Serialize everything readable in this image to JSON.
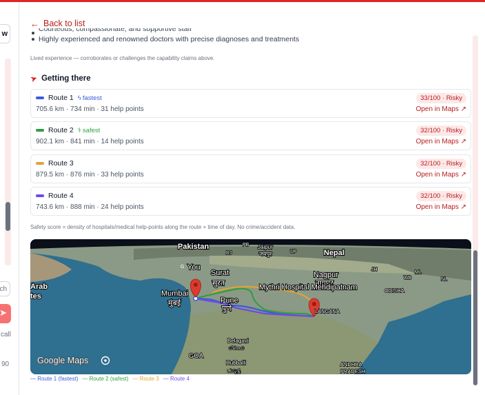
{
  "sidebar": {
    "button_partial": "w",
    "search_partial": "ch",
    "call_partial": "call",
    "count_partial": "90"
  },
  "header": {
    "back_label": "Back to list"
  },
  "reviews": {
    "bullets": [
      "Courteous, compassionate, and supportive staff",
      "Highly experienced and renowned doctors with precise diagnoses and treatments"
    ],
    "note": "Lived experience — corroborates or challenges the capability claims above."
  },
  "getting_there": {
    "title": "Getting there",
    "routes": [
      {
        "name": "Route 1",
        "tag": "fastest",
        "tag_icon": "lightning-icon",
        "color": "#3b5bdb",
        "tag_color": "#3b5bdb",
        "details": "705.6 km · 734 min · 31 help points",
        "score": "33/100 · Risky",
        "link": "Open in Maps"
      },
      {
        "name": "Route 2",
        "tag": "safest",
        "tag_icon": "shield-icon",
        "color": "#2f9e44",
        "tag_color": "#2f9e44",
        "details": "902.1 km · 841 min · 14 help points",
        "score": "32/100 · Risky",
        "link": "Open in Maps"
      },
      {
        "name": "Route 3",
        "tag": "",
        "tag_icon": "",
        "color": "#e0a23a",
        "tag_color": "",
        "details": "879.5 km · 876 min · 33 help points",
        "score": "32/100 · Risky",
        "link": "Open in Maps"
      },
      {
        "name": "Route 4",
        "tag": "",
        "tag_icon": "",
        "color": "#7048e8",
        "tag_color": "",
        "details": "743.6 km · 888 min · 24 help points",
        "score": "32/100 · Risky",
        "link": "Open in Maps"
      }
    ],
    "safety_note": "Safety score = density of hospitals/medical help-points along the route + time of day. No crime/accident data."
  },
  "map": {
    "labels": {
      "pakistan": "Pakistan",
      "nepal": "Nepal",
      "pb": "PB",
      "jaipur": "Jaipur",
      "jaipur_local": "जयपुर",
      "up": "UP",
      "rj": "RJ",
      "jh": "JH",
      "wb": "WB",
      "ml": "ML",
      "nl": "NL",
      "you": "You",
      "surat": "Surat",
      "surat_local": "सुरत",
      "nagpur": "Nagpur",
      "nagpur_local": "नागपुर",
      "destination": "Mythri Hospital Mehdipatnam",
      "odisha": "ODISHA",
      "arab": "Arab",
      "arab2": "tes",
      "mumbai": "Mumbai",
      "mumbai_local": "मुंबई",
      "pune": "Pune",
      "pune_local": "पुणे",
      "telangana": "LANGANA",
      "belagavi": "Belagavi",
      "belagavi_local": "ಬೆಳಗಾವಿ",
      "goa": "GOA",
      "hubballi": "Hubballi",
      "hubballi_local": "ಹುಬ್ಬಳ್ಳಿ",
      "andhra": "ANDHRA",
      "pradesh": "PRADESH",
      "google_maps": "Google Maps",
      "g_letter": "G"
    },
    "legend": [
      {
        "label": "Route 1 (fastest)",
        "color": "#3b5bdb"
      },
      {
        "label": "Route 2 (safest)",
        "color": "#2f9e44"
      },
      {
        "label": "Route 3",
        "color": "#e0a23a"
      },
      {
        "label": "Route 4",
        "color": "#7048e8"
      }
    ]
  }
}
